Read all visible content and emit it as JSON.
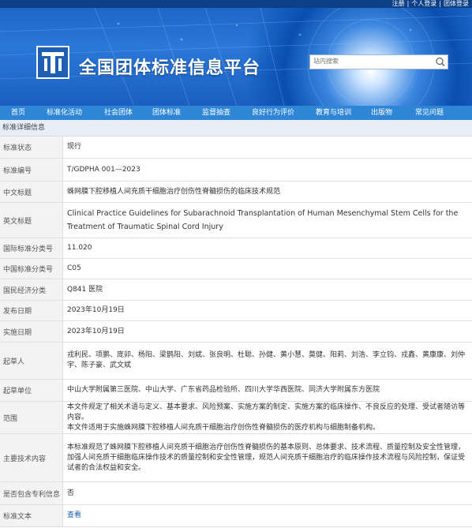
{
  "topbar": {
    "register": "注册",
    "personal_login": "个人登录",
    "group_login": "团体登录",
    "separator": "|"
  },
  "site": {
    "title": "全国团体标准信息平台"
  },
  "search": {
    "placeholder": "站内搜索"
  },
  "nav": {
    "items": [
      "首页",
      "标准化活动",
      "社会团体",
      "团体标准",
      "监督抽查",
      "良好行为评价",
      "教育与培训",
      "出版物",
      "常见问题"
    ]
  },
  "section": {
    "title": "标准详细信息"
  },
  "fields": {
    "status": {
      "label": "标准状态",
      "value": "现行"
    },
    "number": {
      "label": "标准编号",
      "value": "T/GDPHA 001—2023"
    },
    "cn_title": {
      "label": "中文标题",
      "value": "蛛网膜下腔移植人间充质干细胞治疗创伤性脊髓损伤的临床技术规范"
    },
    "en_title": {
      "label": "英文标题",
      "value": "Clinical Practice Guidelines for Subarachnoid Transplantation of Human Mesenchymal Stem Cells for the Treatment of Traumatic Spinal Cord Injury"
    },
    "ics": {
      "label": "国际标准分类号",
      "value": "11.020"
    },
    "ccs": {
      "label": "中国标准分类号",
      "value": "C05"
    },
    "economy": {
      "label": "国民经济分类",
      "value": "Q841 医院"
    },
    "publish_date": {
      "label": "发布日期",
      "value": "2023年10月19日"
    },
    "impl_date": {
      "label": "实施日期",
      "value": "2023年10月19日"
    },
    "drafters": {
      "label": "起草人",
      "value": "戎利民、项鹏、庞卯、杨阳、梁鹊阳、刘斌、张良明、杜聪、孙健、黄小慧、莫健、阳莉、刘浩、李立钧、戎鑫、黄康康、刘仲宇、陈子豪、武文斌"
    },
    "units": {
      "label": "起草单位",
      "value": "中山大学附属第三医院、中山大学、广东省药品检验所、四川大学华西医院、同济大学附属东方医院"
    },
    "scope": {
      "label": "范围",
      "line1": "本文件规定了相关术语与定义、基本要求、风险预案、实施方案的制定、实施方案的临床操作、不良反应的处理、受试者随访等内容。",
      "line2": "本文件适用于实施蛛网膜下腔移植人间充质干细胞治疗创伤性脊髓损伤的医疗机构与细胞制备机构。"
    },
    "tech": {
      "label": "主要技术内容",
      "value": "本标准规范了蛛网膜下腔移植人间充质干细胞治疗创伤性脊髓损伤的基本原则、总体要求、技术流程、质量控制及安全性管理，加强人间充质干细胞临床操作技术的质量控制和安全性管理，规范人间充质干细胞治疗的临床操作技术流程与风险控制，保证受试者的合法权益和安全。"
    },
    "patent": {
      "label": "是否包含专利信息",
      "value": "否"
    },
    "text": {
      "label": "标准文本",
      "value": "查看"
    }
  }
}
